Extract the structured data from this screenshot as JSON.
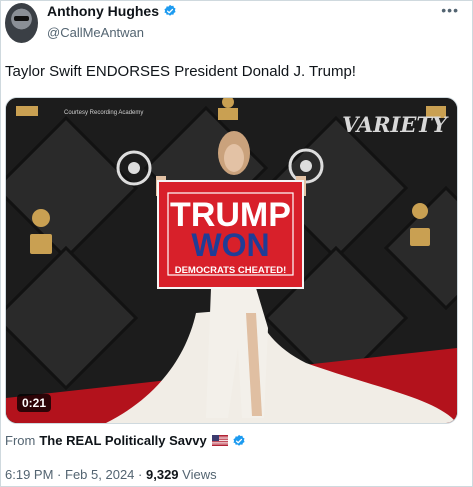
{
  "author": {
    "display_name": "Anthony Hughes",
    "handle": "@CallMeAntwan",
    "verified": true,
    "avatar_icon": "profile-photo"
  },
  "more_icon": "ellipsis-icon",
  "tweet": {
    "text": "Taylor Swift ENDORSES President Donald J. Trump!"
  },
  "media": {
    "duration": "0:21",
    "watermark": "VARIETY",
    "courtesy": "Courtesy Recording Academy",
    "flag": {
      "line1": "TRUMP",
      "line2": "WON",
      "line3": "DEMOCRATS CHEATED!"
    }
  },
  "source": {
    "prefix": "From",
    "name": "The REAL Politically Savvy",
    "flag_icon": "us-flag-emoji",
    "verified": true
  },
  "footer": {
    "time": "6:19 PM",
    "sep1": "·",
    "date": "Feb 5, 2024",
    "sep2": "·",
    "views_count": "9,329",
    "views_label": "Views"
  },
  "colors": {
    "verified_blue": "#1d9bf0",
    "secondary_text": "#536471",
    "carpet_red": "#b3121c",
    "flag_red": "#d8202a",
    "flag_blue": "#1f3d96"
  }
}
